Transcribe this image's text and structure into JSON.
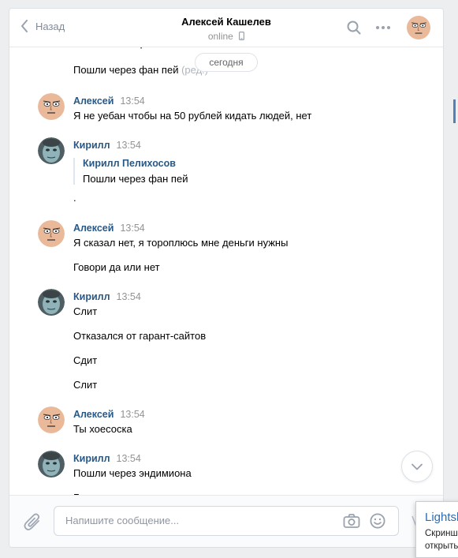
{
  "header": {
    "back_label": "Назад",
    "title": "Алексей Кашелев",
    "status": "online"
  },
  "date_pill": "сегодня",
  "top_cut_text": "и за чем-то торопишь?",
  "messages": [
    {
      "text": "Пошли через фан пей",
      "edited_mark": "(ред.)"
    },
    {
      "sender": "Алексей",
      "time": "13:54",
      "text": "Я не уебан чтобы на 50 рублей кидать людей, нет"
    },
    {
      "sender": "Кирилл",
      "time": "13:54",
      "quote_author": "Кирилл Пелихосов",
      "quote_text": "Пошли через фан пей",
      "text": "."
    },
    {
      "sender": "Алексей",
      "time": "13:54",
      "text": "Я сказал нет, я тороплюсь мне деньги нужны"
    },
    {
      "text": "Говори да или нет"
    },
    {
      "sender": "Кирилл",
      "time": "13:54",
      "text": "Слит"
    },
    {
      "text": "Отказался от гарант-сайтов"
    },
    {
      "text": "Сдит"
    },
    {
      "text": "Слит"
    },
    {
      "sender": "Алексей",
      "time": "13:54",
      "text": "Ты хоесоска"
    },
    {
      "sender": "Кирилл",
      "time": "13:54",
      "text": "Пошли через эндимиона"
    },
    {
      "text": "Гарант"
    }
  ],
  "composer": {
    "placeholder": "Напишите сообщение..."
  },
  "toast": {
    "title": "Lightshot",
    "line1": "Скриншот",
    "line2": "открыть"
  },
  "colors": {
    "link": "#2a5885",
    "accent": "#5181b8",
    "muted": "#939393"
  }
}
